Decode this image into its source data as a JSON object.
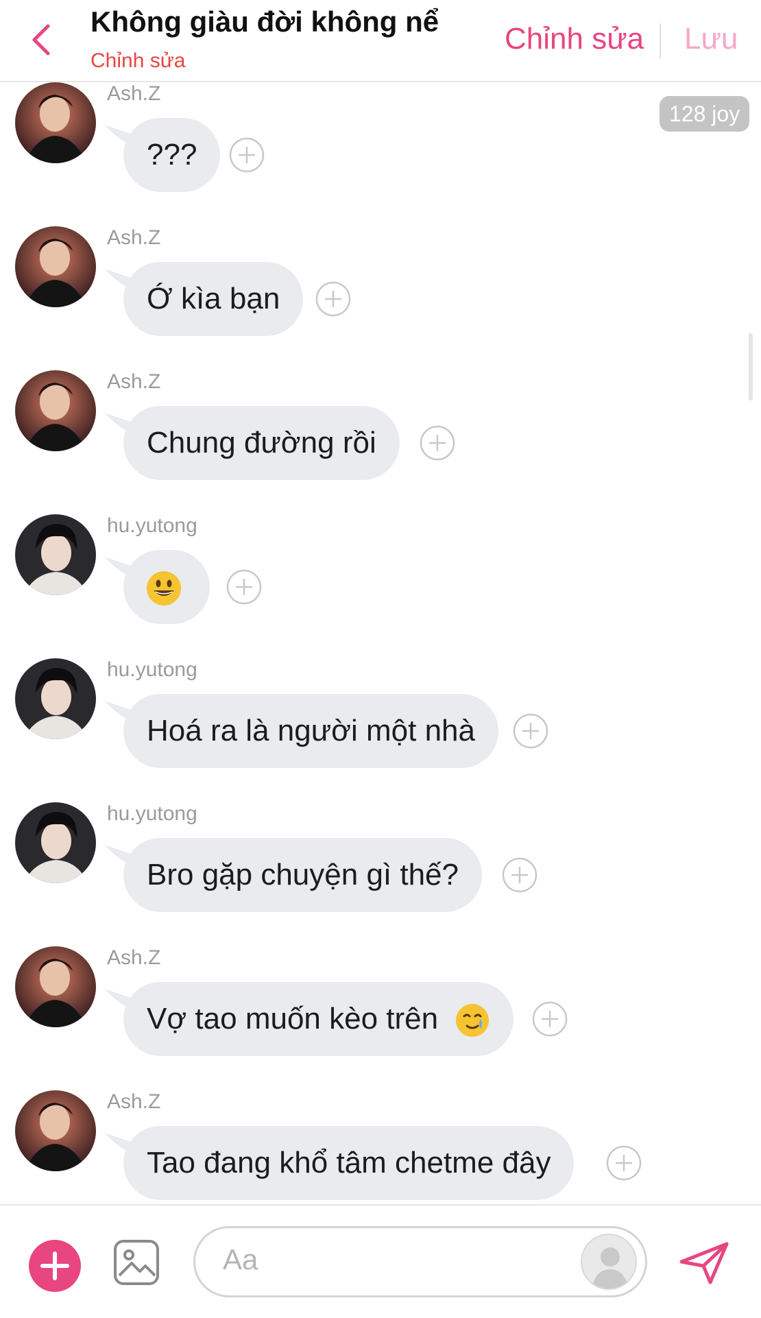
{
  "header": {
    "title": "Không giàu đời không nể",
    "subtitle": "Chỉnh sửa",
    "edit_label": "Chỉnh sửa",
    "save_label": "Lưu"
  },
  "badge": "128 joy",
  "messages": [
    {
      "sender": "Ash.Z",
      "text": "???"
    },
    {
      "sender": "Ash.Z",
      "text": "Ớ kìa bạn"
    },
    {
      "sender": "Ash.Z",
      "text": "Chung đường rồi"
    },
    {
      "sender": "hu.yutong",
      "text": ""
    },
    {
      "sender": "hu.yutong",
      "text": "Hoá ra là người một nhà"
    },
    {
      "sender": "hu.yutong",
      "text": "Bro gặp chuyện gì thế?"
    },
    {
      "sender": "Ash.Z",
      "text": "Vợ tao muốn kèo trên"
    },
    {
      "sender": "Ash.Z",
      "text": "Tao đang khổ tâm chetme đây"
    }
  ],
  "composer": {
    "placeholder": "Aa"
  },
  "colors": {
    "accent": "#e8467f",
    "subtitle": "#e8463e",
    "bubble": "#e9ebee",
    "badge": "#c4c4c4"
  },
  "icons": [
    "back-chevron-icon",
    "plus-circle-icon",
    "add-icon",
    "image-icon",
    "voice-avatar-icon",
    "send-icon",
    "grin-emoji",
    "crying-smile-emoji"
  ]
}
